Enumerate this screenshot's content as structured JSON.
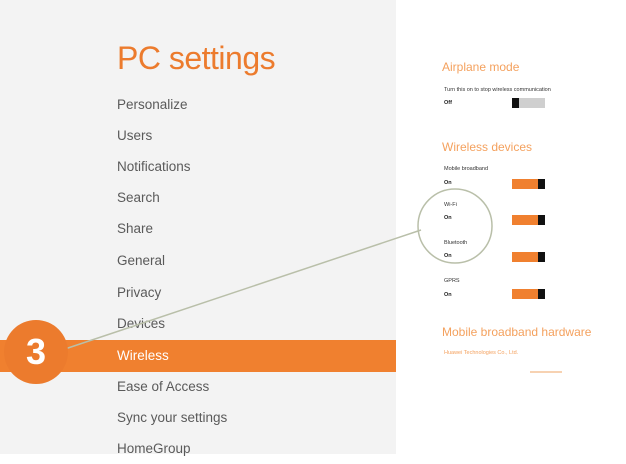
{
  "app_title": "PC settings",
  "nav": {
    "items": [
      {
        "label": "Personalize"
      },
      {
        "label": "Users"
      },
      {
        "label": "Notifications"
      },
      {
        "label": "Search"
      },
      {
        "label": "Share"
      },
      {
        "label": "General"
      },
      {
        "label": "Privacy"
      },
      {
        "label": "Devices"
      },
      {
        "label": "Wireless",
        "selected": true
      },
      {
        "label": "Ease of Access"
      },
      {
        "label": "Sync your settings"
      },
      {
        "label": "HomeGroup"
      }
    ]
  },
  "airplane": {
    "title": "Airplane mode",
    "description": "Turn this on to stop wireless communication",
    "state": "Off"
  },
  "wireless": {
    "title": "Wireless devices",
    "devices": [
      {
        "name": "Mobile broadband",
        "state": "On"
      },
      {
        "name": "Wi-Fi",
        "state": "On"
      },
      {
        "name": "Bluetooth",
        "state": "On"
      },
      {
        "name": "GPRS",
        "state": "On"
      }
    ]
  },
  "hardware": {
    "title": "Mobile broadband hardware",
    "vendor": "Huawei Technologies Co., Ltd."
  },
  "step_badge": "3",
  "colors": {
    "accent": "#f0802f",
    "title": "#ec7b2d",
    "section": "#f4a15e",
    "callout": "#b9bfa9"
  }
}
